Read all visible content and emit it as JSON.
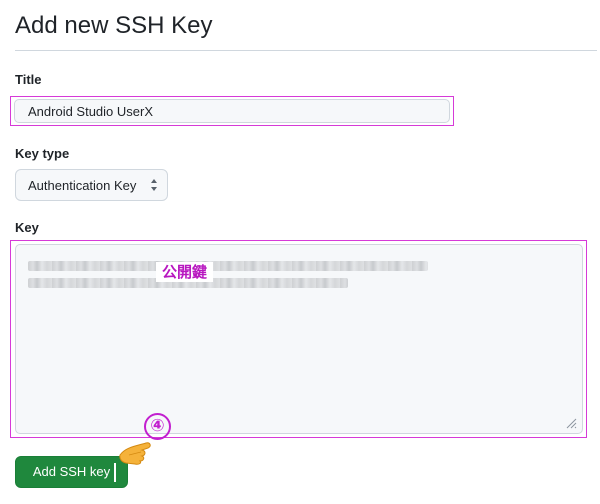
{
  "page": {
    "title": "Add new SSH Key"
  },
  "form": {
    "title_label": "Title",
    "title_value": "Android Studio UserX",
    "key_type_label": "Key type",
    "key_type_selected": "Authentication Key",
    "key_label": "Key",
    "key_annotation": "公開鍵",
    "submit_label": "Add SSH key"
  },
  "annotation": {
    "step_number": "④",
    "color": "#c21fcf"
  },
  "icons": {
    "select_arrow": "updown-arrows-icon",
    "pointer": "pointing-hand-icon",
    "resize": "resize-grip-icon"
  },
  "colors": {
    "primary_button": "#1f883d",
    "highlight_box": "#d63ad8",
    "input_bg": "#f6f8fa"
  }
}
